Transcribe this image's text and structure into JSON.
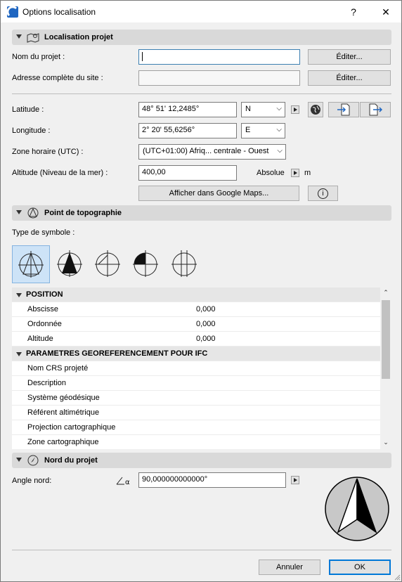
{
  "window": {
    "title": "Options localisation",
    "help_label": "?",
    "close_label": "✕"
  },
  "sections": {
    "location": "Localisation projet",
    "survey": "Point de topographie",
    "north": "Nord du projet"
  },
  "location": {
    "project_name_label": "Nom du projet :",
    "project_name_value": "",
    "address_label": "Adresse complète du site :",
    "address_value": "",
    "edit_label": "Éditer...",
    "latitude_label": "Latitude :",
    "latitude_value": "48° 51' 12,2485°",
    "latitude_dir": "N",
    "longitude_label": "Longitude :",
    "longitude_value": "2° 20' 55,6256°",
    "longitude_dir": "E",
    "timezone_label": "Zone horaire (UTC) :",
    "timezone_value": "(UTC+01:00) Afriq... centrale - Ouest",
    "altitude_label": "Altitude (Niveau de la mer) :",
    "altitude_value": "400,00",
    "altitude_ref": "Absolue",
    "altitude_unit": "m",
    "maps_button": "Afficher dans Google Maps...",
    "info_icon": "i"
  },
  "survey": {
    "symbol_type_label": "Type de symbole :",
    "selected_symbol": 1,
    "table": [
      {
        "type": "header",
        "label": "POSITION"
      },
      {
        "type": "row",
        "label": "Abscisse",
        "value": "0,000"
      },
      {
        "type": "row",
        "label": "Ordonnée",
        "value": "0,000"
      },
      {
        "type": "row",
        "label": "Altitude",
        "value": "0,000"
      },
      {
        "type": "header",
        "label": "PARAMETRES GEOREFERENCEMENT POUR IFC"
      },
      {
        "type": "row",
        "label": "Nom CRS projeté",
        "value": ""
      },
      {
        "type": "row",
        "label": "Description",
        "value": ""
      },
      {
        "type": "row",
        "label": "Système géodésique",
        "value": ""
      },
      {
        "type": "row",
        "label": "Référent altimétrique",
        "value": ""
      },
      {
        "type": "row",
        "label": "Projection cartographique",
        "value": ""
      },
      {
        "type": "row",
        "label": "Zone cartographique",
        "value": ""
      }
    ]
  },
  "north": {
    "angle_label": "Angle nord:",
    "angle_value": "90,000000000000°"
  },
  "footer": {
    "cancel": "Annuler",
    "ok": "OK"
  }
}
